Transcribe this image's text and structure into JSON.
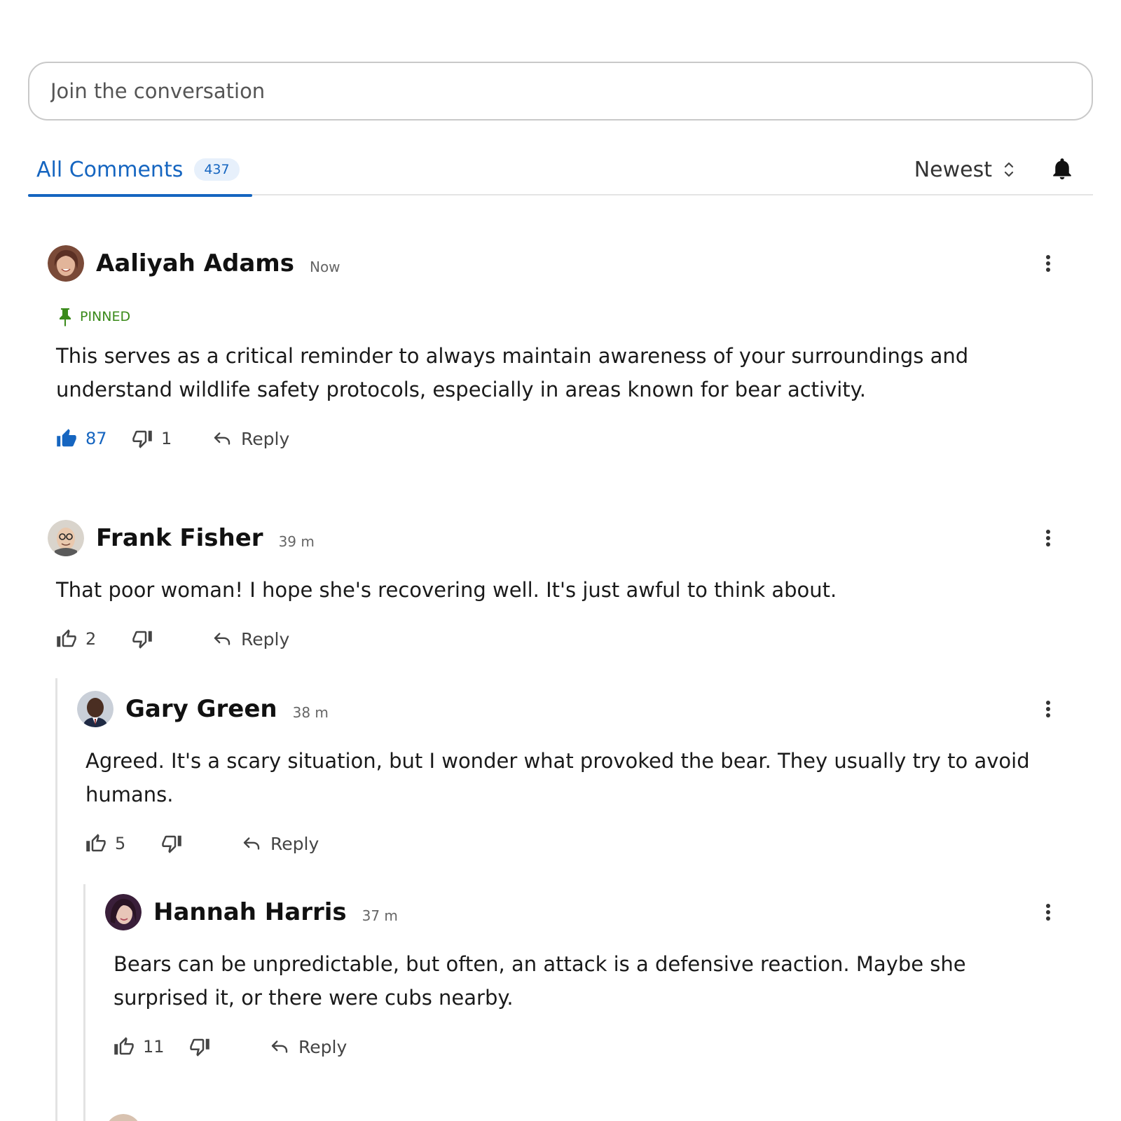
{
  "composer": {
    "placeholder": "Join the conversation"
  },
  "tabs": {
    "active_label": "All Comments",
    "count": "437"
  },
  "sort": {
    "label": "Newest"
  },
  "colors": {
    "accent": "#1565c0",
    "pinned": "#3a8a1a"
  },
  "comments": [
    {
      "author": "Aaliyah Adams",
      "time": "Now",
      "pinned_label": "PINNED",
      "body": "This serves as a critical reminder to always maintain awareness of your surroundings and understand wildlife safety protocols, especially in areas known for bear activity.",
      "likes": "87",
      "dislikes": "1",
      "liked": true,
      "reply_label": "Reply"
    },
    {
      "author": "Frank Fisher",
      "time": "39 m",
      "body": "That poor woman! I hope she's recovering well. It's just awful to think about.",
      "likes": "2",
      "dislikes": "",
      "reply_label": "Reply"
    },
    {
      "author": "Gary Green",
      "time": "38 m",
      "body": "Agreed. It's a scary situation, but I wonder what provoked the bear. They usually try to avoid humans.",
      "likes": "5",
      "dislikes": "",
      "reply_label": "Reply"
    },
    {
      "author": "Hannah Harris",
      "time": "37 m",
      "body": "Bears can be unpredictable, but often, an attack is a defensive reaction. Maybe she surprised it, or there were cubs nearby.",
      "likes": "11",
      "dislikes": "",
      "reply_label": "Reply"
    }
  ]
}
